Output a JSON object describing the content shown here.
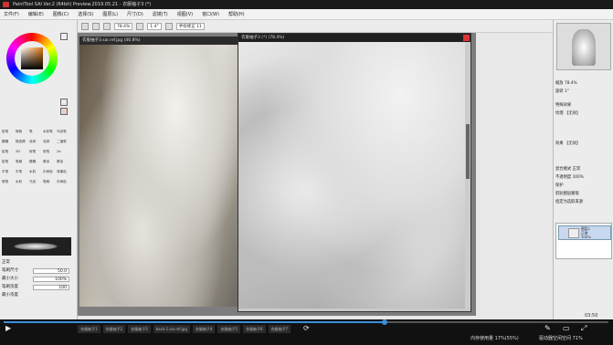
{
  "window": {
    "title": "PaintTool SAI Ver.2 (64bit) Preview.2019.05.21 - 衣服袖子3 (*)"
  },
  "menu": [
    "文件(F)",
    "编辑(E)",
    "图像(C)",
    "选择(S)",
    "图层(L)",
    "尺寸(D)",
    "滤镜(T)",
    "视图(V)",
    "窗口(W)",
    "帮助(H)"
  ],
  "toolbar": {
    "zoom": "78.4%",
    "angle": "1.4°",
    "stabilizer": "手抖修正 11"
  },
  "tools": [
    "铅笔",
    "喷枪",
    "笔",
    "水彩笔",
    "马克笔",
    "模糊",
    "橡皮擦",
    "涂抹",
    "涂抹",
    "二值笔",
    "铅笔",
    "2D",
    "软笔",
    "软笔",
    "2d",
    "铅笔",
    "笔刷",
    "模糊",
    "厚涂",
    "厚涂",
    "平笔",
    "平笔",
    "水彩",
    "中间色",
    "背景色",
    "喷笔",
    "水彩",
    "马克",
    "笔刷",
    "中间色"
  ],
  "brush": {
    "mode": "正常",
    "size_label": "笔刷尺寸",
    "size_value": "50.0",
    "min_label": "最小大小",
    "min_value": "100%",
    "density_label": "笔刷浓度",
    "density_value": "100",
    "texture_label": "最小浓度"
  },
  "canvas": {
    "ref_title": "衣服袖子3.sai.ref.jpg (46.8%)",
    "work_title": "衣服袖子3 (*) (78.4%)"
  },
  "right_panel": {
    "zoom_label": "缩放",
    "zoom_value": "78.4%",
    "angle_label": "旋转",
    "angle_value": "1°",
    "effect_label": "特殊效果",
    "texture_label": "纹理",
    "texture_value": "【无效】",
    "effect2_label": "效果",
    "effect2_value": "【无效】",
    "blend_label": "混合模式",
    "blend_value": "正常",
    "opacity_label": "不透明度",
    "opacity_value": "100%",
    "protect_label": "保护",
    "clip_label": "剪贴图层蒙版",
    "sample_label": "指定为选取来源",
    "layer_name": "图层1\n正常\n100%"
  },
  "player": {
    "progress": 0.63,
    "time": "03:50"
  },
  "taskbar": [
    "衣服袖子1",
    "衣服袖子2",
    "衣服袖子3",
    "back-1.sai.ref.jpg",
    "衣服袖子4",
    "衣服袖子5",
    "衣服袖子6",
    "衣服袖子7"
  ],
  "statusbar": {
    "memory": "内存使用量 17%(55%)",
    "drive": "驱动器空闲空间 71%"
  }
}
